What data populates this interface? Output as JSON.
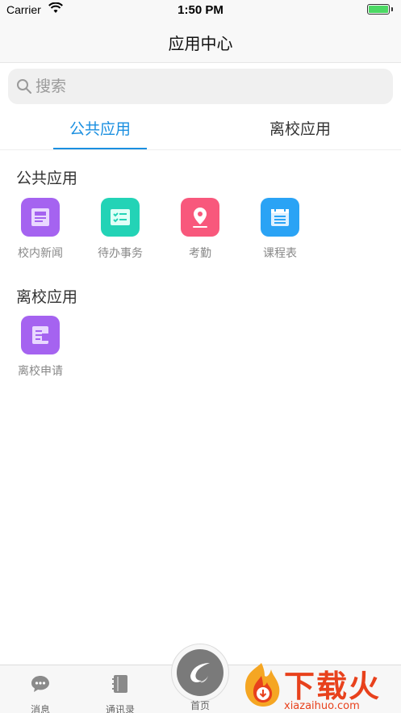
{
  "status_bar": {
    "carrier": "Carrier",
    "time": "1:50 PM",
    "battery_level": 1.0
  },
  "nav": {
    "title": "应用中心"
  },
  "search": {
    "placeholder": "搜索"
  },
  "tabs": [
    {
      "label": "公共应用",
      "active": true
    },
    {
      "label": "离校应用",
      "active": false
    }
  ],
  "sections": [
    {
      "title": "公共应用",
      "apps": [
        {
          "label": "校内新闻",
          "icon": "news-icon",
          "color": "#a563f0"
        },
        {
          "label": "待办事务",
          "icon": "checklist-icon",
          "color": "#23d3b6"
        },
        {
          "label": "考勤",
          "icon": "location-pin-icon",
          "color": "#f8587c"
        },
        {
          "label": "课程表",
          "icon": "calendar-icon",
          "color": "#2aa3f5"
        }
      ]
    },
    {
      "title": "离校应用",
      "apps": [
        {
          "label": "离校申请",
          "icon": "form-icon",
          "color": "#a563f0"
        }
      ]
    }
  ],
  "tab_bar": {
    "items": [
      {
        "label": "消息",
        "icon": "chat-icon"
      },
      {
        "label": "通讯录",
        "icon": "contacts-icon"
      },
      {
        "label": "首页",
        "icon": "home-logo-icon"
      }
    ]
  },
  "watermark": {
    "brand": "下载火",
    "url": "xiazaihuo.com"
  },
  "colors": {
    "accent": "#1a8fe0",
    "watermark": "#e8411c"
  }
}
